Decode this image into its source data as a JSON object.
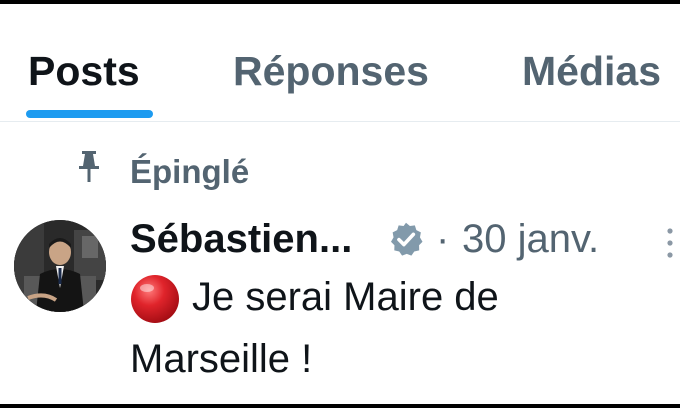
{
  "tabs": [
    {
      "label": "Posts",
      "active": true
    },
    {
      "label": "Réponses",
      "active": false
    },
    {
      "label": "Médias",
      "active": false
    }
  ],
  "pinned": {
    "label": "Épinglé",
    "icon": "pin-icon"
  },
  "post": {
    "author_name": "Sébastien...",
    "verified_icon": "verified-badge-icon",
    "separator": "·",
    "date": "30 janv.",
    "emoji_icon": "red-circle-icon",
    "text": "Je serai Maire de Marseille !"
  },
  "colors": {
    "accent": "#1d9bf0",
    "text_primary": "#0f1419",
    "text_secondary": "#536471",
    "verified_badge": "#829aab",
    "red_circle": "#e0242b"
  }
}
